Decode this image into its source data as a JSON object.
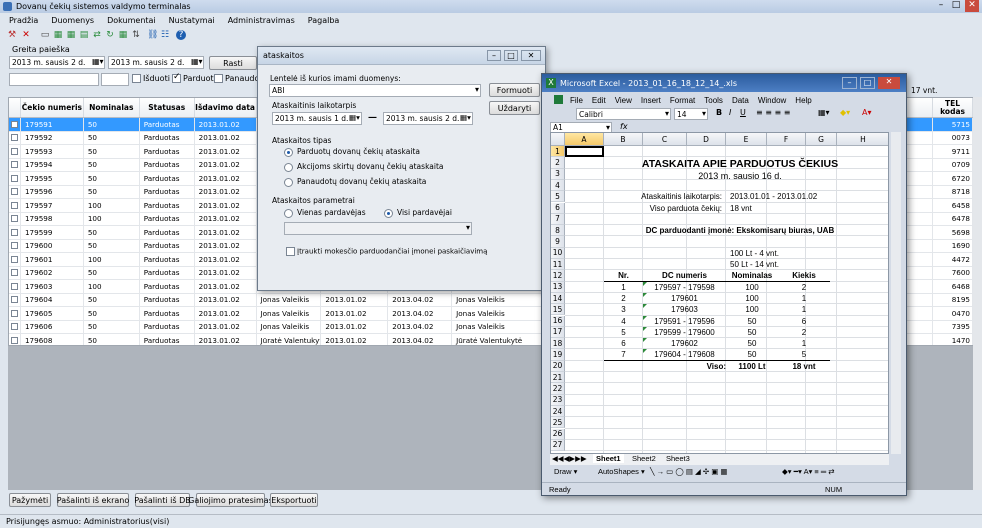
{
  "app": {
    "title": "Dovanų čekių sistemos valdymo terminalas"
  },
  "menu": [
    "Pradžia",
    "Duomenys",
    "Dokumentai",
    "Nustatymai",
    "Administravimas",
    "Pagalba"
  ],
  "search": {
    "label": "Greita paieška",
    "from_date": "2013 m.  sausis    2 d.",
    "to_date": "2013 m.  sausis    2 d.",
    "button": "Rasti",
    "chk_issued": "Išduoti",
    "chk_sold": "Parduoti",
    "chk_used": "Panaudoti"
  },
  "grid": {
    "headers": [
      "Čekio numeris",
      "Nominalas",
      "Statusas",
      "Išdavimo data",
      "",
      "",
      "",
      "",
      "TEL kodas"
    ],
    "right_values": [
      "5715",
      "0073",
      "9711",
      "0709",
      "6720",
      "8718",
      "6458",
      "6478",
      "5698",
      "1690",
      "4472",
      "7600",
      "6468",
      "8195",
      "0470",
      "7395",
      "1470"
    ],
    "rows": [
      [
        "179591",
        "50",
        "Parduotas",
        "2013.01.02",
        "Jo",
        "",
        "",
        "",
        ""
      ],
      [
        "179592",
        "50",
        "Parduotas",
        "2013.01.02",
        "Jo",
        "",
        "",
        "",
        ""
      ],
      [
        "179593",
        "50",
        "Parduotas",
        "2013.01.02",
        "Jo",
        "",
        "",
        "",
        ""
      ],
      [
        "179594",
        "50",
        "Parduotas",
        "2013.01.02",
        "Jo",
        "",
        "",
        "",
        ""
      ],
      [
        "179595",
        "50",
        "Parduotas",
        "2013.01.02",
        "Jo",
        "",
        "",
        "",
        ""
      ],
      [
        "179596",
        "50",
        "Parduotas",
        "2013.01.02",
        "Jo",
        "",
        "",
        "",
        ""
      ],
      [
        "179597",
        "100",
        "Parduotas",
        "2013.01.02",
        "Jo",
        "",
        "",
        "",
        ""
      ],
      [
        "179598",
        "100",
        "Parduotas",
        "2013.01.02",
        "Jo",
        "",
        "",
        "",
        ""
      ],
      [
        "179599",
        "50",
        "Parduotas",
        "2013.01.02",
        "Jo",
        "",
        "",
        "",
        ""
      ],
      [
        "179600",
        "50",
        "Parduotas",
        "2013.01.02",
        "Jo",
        "",
        "",
        "",
        ""
      ],
      [
        "179601",
        "100",
        "Parduotas",
        "2013.01.02",
        "Jo",
        "",
        "",
        "",
        ""
      ],
      [
        "179602",
        "50",
        "Parduotas",
        "2013.01.02",
        "Jo",
        "",
        "",
        "",
        ""
      ],
      [
        "179603",
        "100",
        "Parduotas",
        "2013.01.02",
        "Jo",
        "",
        "",
        "",
        ""
      ],
      [
        "179604",
        "50",
        "Parduotas",
        "2013.01.02",
        "Jonas Valeikis",
        "2013.01.02",
        "2013.04.02",
        "Jonas Valeikis",
        ""
      ],
      [
        "179605",
        "50",
        "Parduotas",
        "2013.01.02",
        "Jonas Valeikis",
        "2013.01.02",
        "2013.04.02",
        "Jonas Valeikis",
        ""
      ],
      [
        "179606",
        "50",
        "Parduotas",
        "2013.01.02",
        "Jonas Valeikis",
        "2013.01.02",
        "2013.04.02",
        "Jonas Valeikis",
        ""
      ],
      [
        "179608",
        "50",
        "Parduotas",
        "2013.01.02",
        "Jūratė Valentukytė",
        "2013.01.02",
        "2013.04.02",
        "Jūratė Valentukytė",
        ""
      ]
    ]
  },
  "footer_buttons": [
    "Pažymėti",
    "Pašalinti iš ekrano",
    "Pašalinti iš DB",
    "Galiojimo pratesimas",
    "Eksportuoti"
  ],
  "status": "Prisijungęs asmuo: Administratorius(visi)",
  "dialog": {
    "title": "ataskaitos",
    "table_label": "Lentelė iš kurios imami duomenys:",
    "table_value": "ABI",
    "btn_form": "Formuoti",
    "btn_close": "Uždaryti",
    "period_label": "Ataskaitinis laikotarpis",
    "period_from": "2013 m.  sausis    1 d.",
    "period_to": "2013 m.  sausis    2 d.",
    "type_label": "Ataskaitos tipas",
    "types": [
      "Parduotų dovanų čekių ataskaita",
      "Akcijoms skirtų dovanų čekių ataskaita",
      "Panaudotų dovanų čekių ataskaita"
    ],
    "params_label": "Ataskaitos parametrai",
    "param_one": "Vienas pardavėjas",
    "param_all": "Visi pardavėjai",
    "tax_chk": "Įtraukti mokesčio parduodančiai įmonei paskaičiavimą"
  },
  "excel": {
    "title": "Microsoft Excel - 2013_01_16_18_12_14_.xls",
    "menu": [
      "File",
      "Edit",
      "View",
      "Insert",
      "Format",
      "Tools",
      "Data",
      "Window",
      "Help"
    ],
    "font": "Calibri",
    "size": "14",
    "cellref": "A1",
    "cols": [
      "A",
      "B",
      "C",
      "D",
      "E",
      "F",
      "G",
      "H"
    ],
    "rows": [
      "1",
      "2",
      "3",
      "4",
      "5",
      "6",
      "7",
      "8",
      "9",
      "10",
      "11",
      "12",
      "13",
      "14",
      "15",
      "16",
      "17",
      "18",
      "19",
      "20",
      "21",
      "22",
      "23",
      "24",
      "25",
      "26",
      "27"
    ],
    "report_title": "ATASKAITA APIE PARDUOTUS ČEKIUS",
    "report_date": "2013 m. sausio 16 d.",
    "period_label": "Ataskaitinis laikotarpis:",
    "period_value": "2013.01.01 - 2013.01.02",
    "sold_label": "Viso parduota čekių:",
    "sold_value": "18 vnt",
    "company": "DC parduodanti įmonė: Ekskomisarų biuras, UAB",
    "nom100": "100 Lt - 4 vnt.",
    "nom50": "50 Lt - 14 vnt.",
    "th": [
      "Nr.",
      "DC numeris",
      "Nominalas",
      "Kiekis"
    ],
    "table": [
      [
        "1",
        "179597 - 179598",
        "100",
        "2"
      ],
      [
        "2",
        "179601",
        "100",
        "1"
      ],
      [
        "3",
        "179603",
        "100",
        "1"
      ],
      [
        "4",
        "179591 - 179596",
        "50",
        "6"
      ],
      [
        "5",
        "179599 - 179600",
        "50",
        "2"
      ],
      [
        "6",
        "179602",
        "50",
        "1"
      ],
      [
        "7",
        "179604 - 179608",
        "50",
        "5"
      ]
    ],
    "total_label": "Viso:",
    "total_nom": "1100 Lt",
    "total_qty": "18 vnt",
    "sheets": [
      "Sheet1",
      "Sheet2",
      "Sheet3"
    ],
    "draw": "Draw ▾",
    "autoshapes": "AutoShapes ▾",
    "status_ready": "Ready",
    "status_num": "NUM",
    "side_label": "17 vnt."
  }
}
